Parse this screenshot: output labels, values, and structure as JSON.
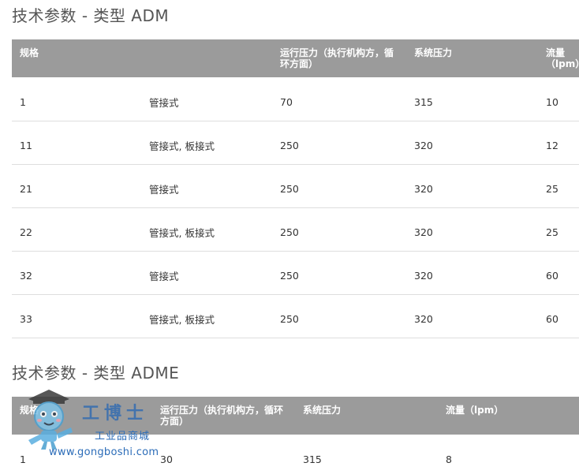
{
  "section1": {
    "title": "技术参数 - 类型 ADM",
    "headers": [
      "规格",
      "",
      "运行压力（执行机构方，循环方面）",
      "系统压力",
      "流量（lpm）"
    ],
    "rows": [
      [
        "1",
        "管接式",
        "70",
        "315",
        "10"
      ],
      [
        "11",
        "管接式, 板接式",
        "250",
        "320",
        "12"
      ],
      [
        "21",
        "管接式",
        "250",
        "320",
        "25"
      ],
      [
        "22",
        "管接式, 板接式",
        "250",
        "320",
        "25"
      ],
      [
        "32",
        "管接式",
        "250",
        "320",
        "60"
      ],
      [
        "33",
        "管接式, 板接式",
        "250",
        "320",
        "60"
      ]
    ]
  },
  "section2": {
    "title": "技术参数 - 类型 ADME",
    "headers": [
      "规格",
      "运行压力（执行机构方，循环方面）",
      "系统压力",
      "流量（lpm）"
    ],
    "rows": [
      [
        "1",
        "30",
        "315",
        "8"
      ]
    ]
  },
  "watermark": {
    "brand": "工博士",
    "subtitle": "工业品商城",
    "site": "www.gongboshi.com"
  }
}
